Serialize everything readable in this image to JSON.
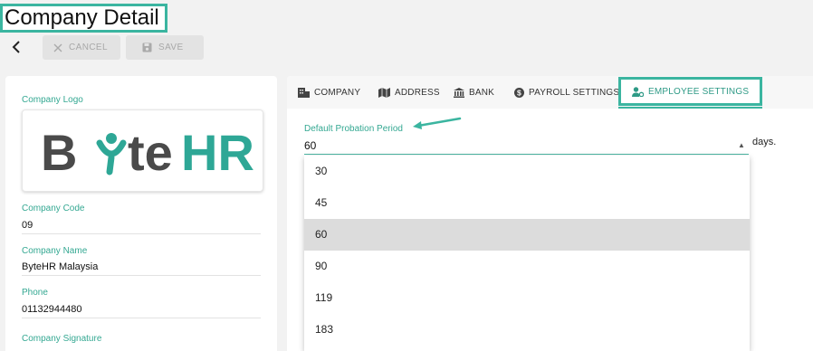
{
  "page": {
    "title": "Company Detail"
  },
  "toolbar": {
    "cancel_label": "CANCEL",
    "save_label": "SAVE"
  },
  "company": {
    "logo_label": "Company Logo",
    "logo_text": "ByteHR",
    "code_label": "Company Code",
    "code_value": "09",
    "name_label": "Company Name",
    "name_value": "ByteHR Malaysia",
    "phone_label": "Phone",
    "phone_value": "01132944480",
    "signature_label": "Company Signature"
  },
  "tabs": [
    {
      "label": "COMPANY",
      "icon": "building-icon"
    },
    {
      "label": "ADDRESS",
      "icon": "map-icon"
    },
    {
      "label": "BANK",
      "icon": "bank-icon"
    },
    {
      "label": "PAYROLL SETTINGS",
      "icon": "dollar-icon"
    },
    {
      "label": "EMPLOYEE SETTINGS",
      "icon": "user-settings-icon",
      "active": true
    }
  ],
  "probation": {
    "label": "Default Probation Period",
    "value": "60",
    "unit": "days.",
    "options": [
      "30",
      "45",
      "60",
      "90",
      "119",
      "183"
    ],
    "selected": "60"
  },
  "colors": {
    "accent": "#3bb5a0",
    "logo_dark": "#4a4a4a",
    "logo_teal": "#2ea796"
  }
}
